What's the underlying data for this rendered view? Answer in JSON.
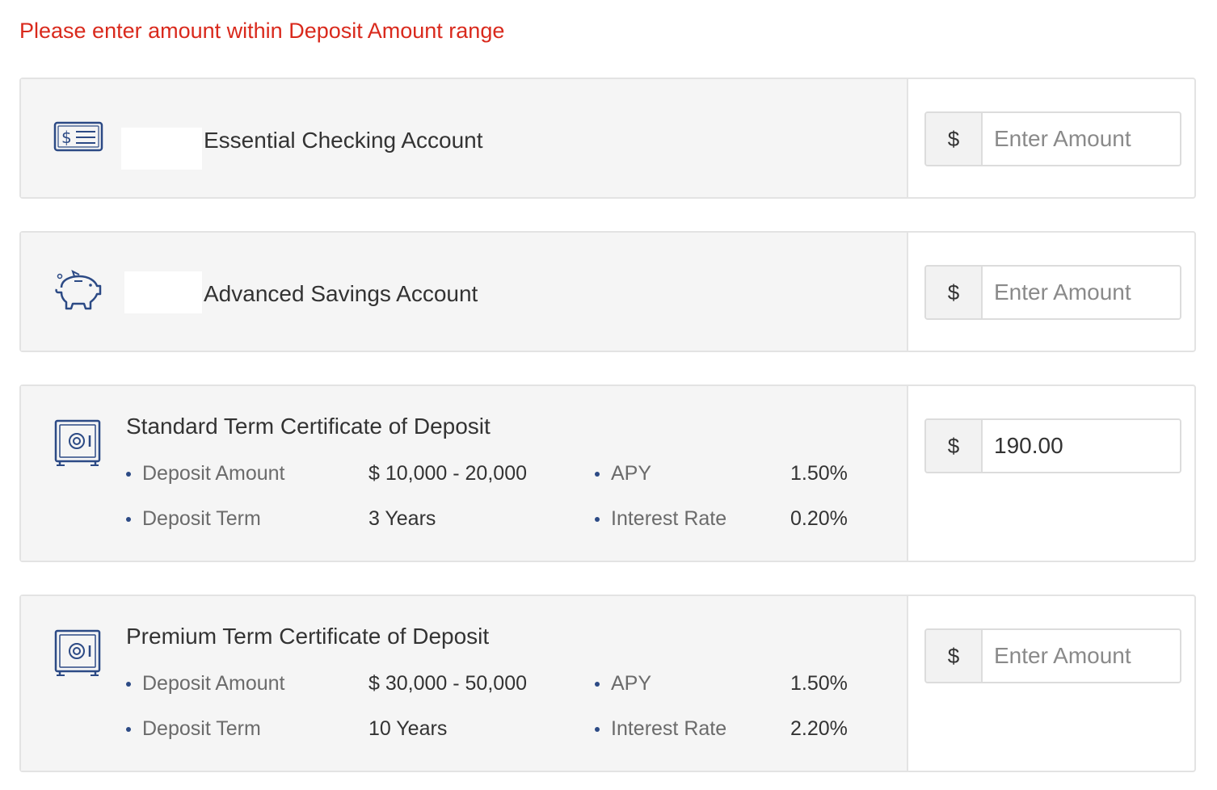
{
  "error_message": "Please enter amount within Deposit Amount range",
  "colors": {
    "error": "#d9291c",
    "icon": "#2c4a85",
    "card_bg": "#f5f5f5",
    "border": "#e3e3e3"
  },
  "accounts": [
    {
      "title": "Essential Checking Account",
      "icon": "check-icon",
      "currency_symbol": "$",
      "amount_value": "",
      "amount_placeholder": "Enter Amount"
    },
    {
      "title": "Advanced Savings Account",
      "icon": "piggy-bank-icon",
      "currency_symbol": "$",
      "amount_value": "",
      "amount_placeholder": "Enter Amount"
    },
    {
      "title": "Standard Term Certificate of Deposit",
      "icon": "safe-icon",
      "currency_symbol": "$",
      "amount_value": "190.00",
      "amount_placeholder": "Enter Amount",
      "details": {
        "deposit_amount_label": "Deposit Amount",
        "deposit_amount_value": "$ 10,000 - 20,000",
        "deposit_term_label": "Deposit Term",
        "deposit_term_value": "3 Years",
        "apy_label": "APY",
        "apy_value": "1.50%",
        "interest_rate_label": "Interest Rate",
        "interest_rate_value": "0.20%"
      }
    },
    {
      "title": "Premium Term Certificate of Deposit",
      "icon": "safe-icon",
      "currency_symbol": "$",
      "amount_value": "",
      "amount_placeholder": "Enter Amount",
      "details": {
        "deposit_amount_label": "Deposit Amount",
        "deposit_amount_value": "$ 30,000 - 50,000",
        "deposit_term_label": "Deposit Term",
        "deposit_term_value": "10 Years",
        "apy_label": "APY",
        "apy_value": "1.50%",
        "interest_rate_label": "Interest Rate",
        "interest_rate_value": "2.20%"
      }
    }
  ]
}
